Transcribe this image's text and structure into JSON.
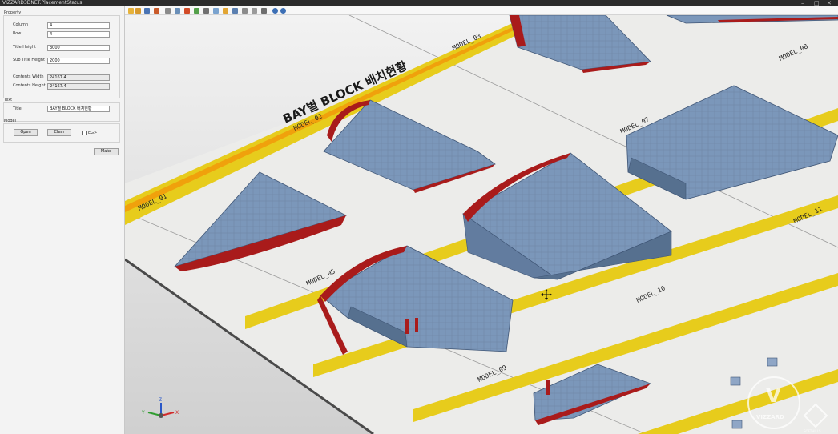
{
  "window": {
    "title": "VIZZARD3DNET.PlacementStatus"
  },
  "property": {
    "group_label": "Property",
    "column_label": "Column",
    "column_value": "4",
    "row_label": "Row",
    "row_value": "4",
    "title_height_label": "Title Height",
    "title_height_value": "3000",
    "sub_title_height_label": "Sub Title Height",
    "sub_title_height_value": "2000",
    "contents_width_label": "Contents Width",
    "contents_width_value": "24167.4",
    "contents_height_label": "Contents Height",
    "contents_height_value": "24167.4"
  },
  "text": {
    "group_label": "Text",
    "title_label": "Title",
    "title_value": "BAY별 BLOCK 배치현황"
  },
  "model": {
    "group_label": "Model",
    "open_label": "Open",
    "clear_label": "Clear",
    "edge_label": "EG>"
  },
  "make_label": "Make",
  "scene": {
    "banner_title": "BAY별  BLOCK  배치현황",
    "models": [
      "MODEL_01",
      "MODEL_02",
      "MODEL_03",
      "MODEL_05",
      "MODEL_07",
      "MODEL_08",
      "MODEL_09",
      "MODEL_10",
      "MODEL_11"
    ],
    "axis_labels": {
      "x": "X",
      "y": "Y",
      "z": "Z"
    },
    "watermark": "VIZZARD",
    "watermark_sub": "SOFTHILLS"
  },
  "colors": {
    "stripe": "#e7cc1c",
    "banner": "#f0a10c",
    "steel": "#7b97ba",
    "hull": "#a91b1b",
    "floor": "#ececea"
  }
}
